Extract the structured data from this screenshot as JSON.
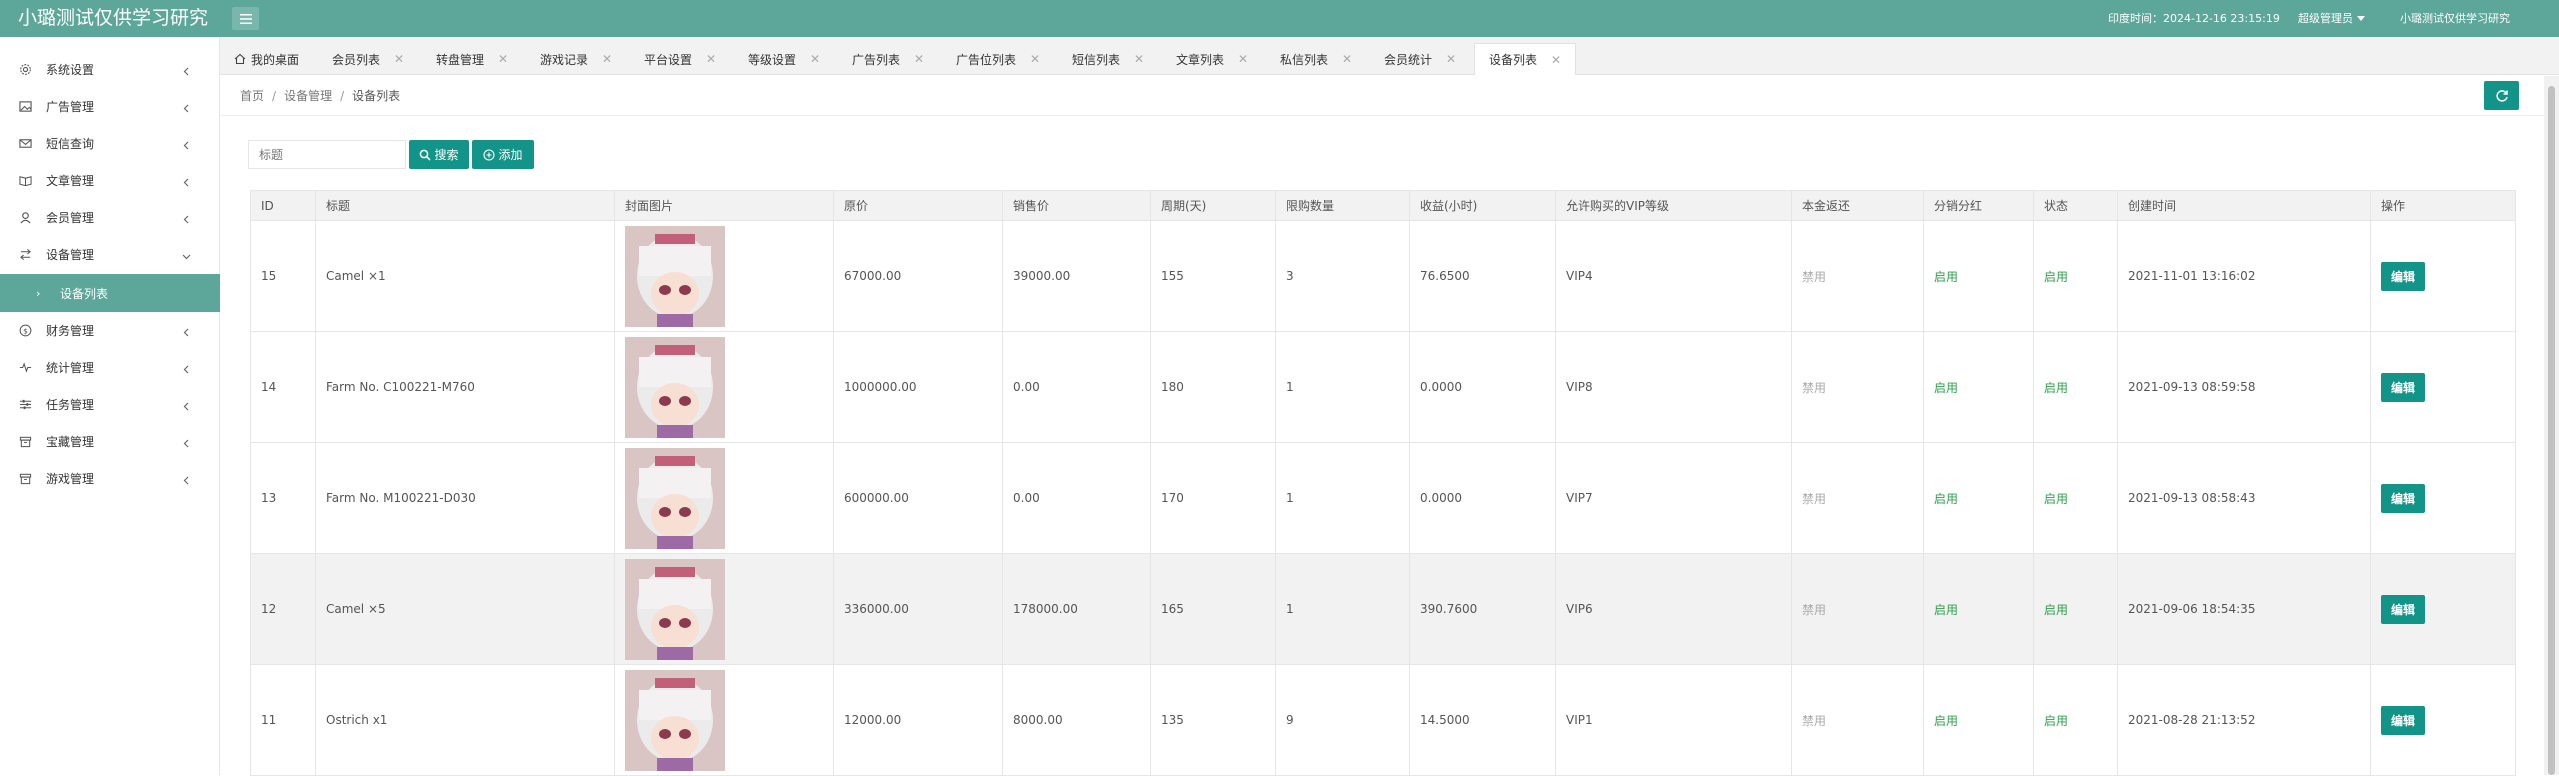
{
  "header": {
    "logo": "小璐测试仅供学习研究",
    "time": "印度时间：2024-12-16 23:15:19",
    "admin": "超级管理员",
    "site": "小璐测试仅供学习研究",
    "bg_color": "#5ca79a"
  },
  "sidebar": {
    "items": [
      {
        "label": "系统设置",
        "icon": "gear-icon"
      },
      {
        "label": "广告管理",
        "icon": "image-icon"
      },
      {
        "label": "短信查询",
        "icon": "mail-icon"
      },
      {
        "label": "文章管理",
        "icon": "book-icon"
      },
      {
        "label": "会员管理",
        "icon": "user-icon"
      },
      {
        "label": "设备管理",
        "icon": "transfer-icon"
      },
      {
        "label": "财务管理",
        "icon": "dollar-icon"
      },
      {
        "label": "统计管理",
        "icon": "pulse-icon"
      },
      {
        "label": "任务管理",
        "icon": "sliders-icon"
      },
      {
        "label": "宝藏管理",
        "icon": "box-icon"
      },
      {
        "label": "游戏管理",
        "icon": "box-icon"
      }
    ],
    "active_sub": "设备列表"
  },
  "tabs": [
    {
      "label": "我的桌面",
      "icon": "home-icon"
    },
    {
      "label": "会员列表"
    },
    {
      "label": "转盘管理"
    },
    {
      "label": "游戏记录"
    },
    {
      "label": "平台设置"
    },
    {
      "label": "等级设置"
    },
    {
      "label": "广告列表"
    },
    {
      "label": "广告位列表"
    },
    {
      "label": "短信列表"
    },
    {
      "label": "文章列表"
    },
    {
      "label": "私信列表"
    },
    {
      "label": "会员统计"
    },
    {
      "label": "设备列表"
    }
  ],
  "tab_close": "✕",
  "breadcrumb": {
    "home": "首页",
    "parent": "设备管理",
    "current": "设备列表",
    "sep": "/"
  },
  "search": {
    "placeholder": "标题",
    "search_label": "搜索",
    "add_label": "添加"
  },
  "table": {
    "columns": [
      "ID",
      "标题",
      "封面图片",
      "原价",
      "销售价",
      "周期(天)",
      "限购数量",
      "收益(小时)",
      "允许购买的VIP等级",
      "本金返还",
      "分销分红",
      "状态",
      "创建时间",
      "操作"
    ],
    "edit_label": "编辑",
    "rows": [
      {
        "id": "15",
        "title": "Camel ×1",
        "price": "67000.00",
        "sale": "39000.00",
        "cycle": "155",
        "limit": "3",
        "income": "76.6500",
        "vip": "VIP4",
        "refund": "禁用",
        "dist": "启用",
        "status": "启用",
        "created": "2021-11-01 13:16:02"
      },
      {
        "id": "14",
        "title": "Farm No. C100221-M760",
        "price": "1000000.00",
        "sale": "0.00",
        "cycle": "180",
        "limit": "1",
        "income": "0.0000",
        "vip": "VIP8",
        "refund": "禁用",
        "dist": "启用",
        "status": "启用",
        "created": "2021-09-13 08:59:58"
      },
      {
        "id": "13",
        "title": "Farm No. M100221-D030",
        "price": "600000.00",
        "sale": "0.00",
        "cycle": "170",
        "limit": "1",
        "income": "0.0000",
        "vip": "VIP7",
        "refund": "禁用",
        "dist": "启用",
        "status": "启用",
        "created": "2021-09-13 08:58:43"
      },
      {
        "id": "12",
        "title": "Camel ×5",
        "price": "336000.00",
        "sale": "178000.00",
        "cycle": "165",
        "limit": "1",
        "income": "390.7600",
        "vip": "VIP6",
        "refund": "禁用",
        "dist": "启用",
        "status": "启用",
        "created": "2021-09-06 18:54:35"
      },
      {
        "id": "11",
        "title": "Ostrich x1",
        "price": "12000.00",
        "sale": "8000.00",
        "cycle": "135",
        "limit": "9",
        "income": "14.5000",
        "vip": "VIP1",
        "refund": "禁用",
        "dist": "启用",
        "status": "启用",
        "created": "2021-08-28 21:13:52"
      }
    ]
  }
}
